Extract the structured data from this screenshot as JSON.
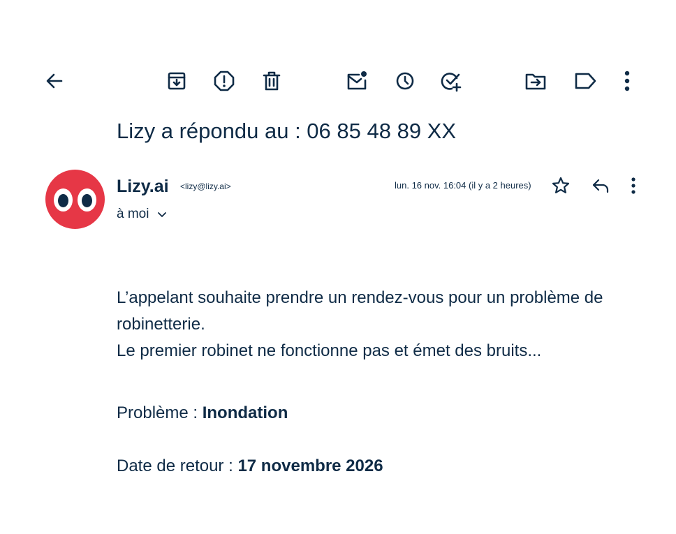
{
  "toolbar": {
    "icons": [
      "back-arrow-icon",
      "archive-icon",
      "report-spam-icon",
      "delete-icon",
      "mark-unread-icon",
      "snooze-icon",
      "add-task-icon",
      "move-to-icon",
      "label-icon",
      "more-vert-icon"
    ]
  },
  "email": {
    "subject": "Lizy a répondu au : 06 85 48 89 XX",
    "sender": {
      "name": "Lizy.ai",
      "email": "<lizy@lizy.ai>",
      "avatar_color": "#e63746"
    },
    "recipient_label": "à moi",
    "timestamp": "lun. 16 nov. 16:04 (il y a 2 heures)",
    "body_lines": [
      "L’appelant souhaite prendre un rendez-vous pour un problème de robinetterie.",
      "Le premier robinet ne fonctionne pas et émet des bruits..."
    ],
    "problem": {
      "label": "Problème : ",
      "value": "Inondation"
    },
    "return_date": {
      "label": "Date de retour : ",
      "value": "17 novembre 2026"
    }
  },
  "colors": {
    "text": "#0f2b46",
    "accent": "#e63746",
    "background": "#ffffff"
  }
}
